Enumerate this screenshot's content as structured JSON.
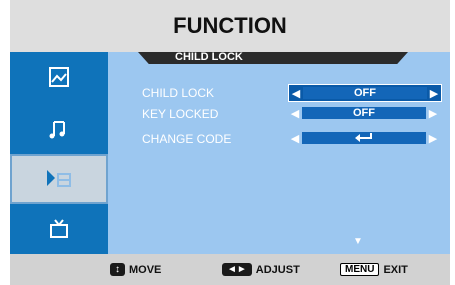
{
  "header": {
    "title": "FUNCTION"
  },
  "sidebar": {
    "items": [
      {
        "icon": "picture-icon",
        "selected": false
      },
      {
        "icon": "music-note-icon",
        "selected": false
      },
      {
        "icon": "function-icon",
        "selected": true
      },
      {
        "icon": "tv-icon",
        "selected": false
      }
    ]
  },
  "submenu": {
    "title": "CHILD LOCK",
    "rows": [
      {
        "label": "CHILD LOCK",
        "value": "OFF",
        "active": true
      },
      {
        "label": "KEY LOCKED",
        "value": "OFF",
        "active": false
      },
      {
        "label": "CHANGE CODE",
        "value": "",
        "icon": "enter-icon",
        "active": false
      }
    ]
  },
  "footer": {
    "move_key": "↕",
    "move_label": "MOVE",
    "adjust_key": "◄►",
    "adjust_label": "ADJUST",
    "exit_key": "MENU",
    "exit_label": "EXIT"
  },
  "colors": {
    "header_bg": "#dedede",
    "sidebar_bg": "#0f73ba",
    "main_bg": "#9cc7f0",
    "value_bg": "#1366b8"
  }
}
